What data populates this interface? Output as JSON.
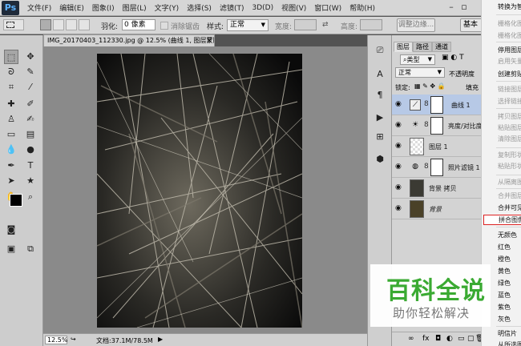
{
  "app": {
    "logo": "Ps"
  },
  "menubar": {
    "items": [
      "文件(F)",
      "编辑(E)",
      "图象(I)",
      "图层(L)",
      "文字(Y)",
      "选择(S)",
      "滤镜(T)",
      "3D(D)",
      "视图(V)",
      "窗口(W)",
      "帮助(H)"
    ]
  },
  "options": {
    "feather_label": "羽化:",
    "feather_value": "0 像素",
    "antialias_label": "消除锯齿",
    "style_label": "样式:",
    "style_value": "正常",
    "width_label": "宽度:",
    "height_label": "高度:",
    "refine_button": "调整边缘...",
    "workspace": "基本"
  },
  "document": {
    "tab_title": "IMG_20170403_112330.jpg @ 12.5% (曲线 1, 图层蒙版/8) *",
    "zoom": "12.5%",
    "doc_size": "文档:37.1M/78.5M"
  },
  "layers_panel": {
    "tabs": [
      "图层",
      "路径",
      "通道"
    ],
    "kind_filter": "类型",
    "blend_mode": "正常",
    "opacity_label": "不透明度",
    "lock_label": "锁定:",
    "fill_label": "填充",
    "layers": [
      {
        "name": "曲线 1",
        "visible": true,
        "type": "adjustment-curves",
        "selected": true
      },
      {
        "name": "亮度/对比度 1",
        "visible": true,
        "type": "adjustment-brightness",
        "selected": false
      },
      {
        "name": "图层 1",
        "visible": true,
        "type": "transparent",
        "selected": false
      },
      {
        "name": "照片滤镜 1",
        "visible": true,
        "type": "adjustment-photofilter",
        "selected": false
      },
      {
        "name": "背景 拷贝",
        "visible": true,
        "type": "image",
        "selected": false
      },
      {
        "name": "背景",
        "visible": true,
        "type": "image-locked",
        "selected": false
      }
    ],
    "footer_icons": [
      "link-icon",
      "fx-icon",
      "mask-icon",
      "adjustment-icon",
      "group-icon",
      "new-layer-icon",
      "trash-icon"
    ]
  },
  "context_menu": {
    "items": [
      {
        "label": "转换为智能对象",
        "dim": false
      },
      {
        "label": "栅格化图层",
        "dim": true
      },
      {
        "label": "栅格化图层样式",
        "dim": true
      },
      {
        "label": "停用图层蒙版",
        "dim": false
      },
      {
        "label": "启用矢量蒙版",
        "dim": true
      },
      {
        "label": "创建剪贴蒙版",
        "dim": false
      },
      {
        "label": "链接图层",
        "dim": true
      },
      {
        "label": "选择链接图层",
        "dim": true
      },
      {
        "label": "拷贝图层样式",
        "dim": true
      },
      {
        "label": "粘贴图层样式",
        "dim": true
      },
      {
        "label": "清除图层样式",
        "dim": true
      },
      {
        "label": "复制形状属性",
        "dim": true
      },
      {
        "label": "粘贴形状属性",
        "dim": true
      },
      {
        "label": "从隔离图层释放",
        "dim": true
      },
      {
        "label": "合并图层",
        "dim": true
      },
      {
        "label": "合并可见图层",
        "dim": false
      },
      {
        "label": "拼合图像",
        "dim": false,
        "highlight": true
      },
      {
        "label": "无颜色",
        "dim": false
      },
      {
        "label": "红色",
        "dim": false
      },
      {
        "label": "橙色",
        "dim": false
      },
      {
        "label": "黄色",
        "dim": false
      },
      {
        "label": "绿色",
        "dim": false
      },
      {
        "label": "蓝色",
        "dim": false
      },
      {
        "label": "紫色",
        "dim": false
      },
      {
        "label": "灰色",
        "dim": false
      },
      {
        "label": "明信片",
        "dim": false
      },
      {
        "label": "从所选图层新建3D模型",
        "dim": false
      }
    ]
  },
  "watermark": {
    "title": "百科全说",
    "subtitle": "助你轻松解决"
  },
  "colors": {
    "ps_blue": "#5fb4ff",
    "selected_layer": "#b7c9e6",
    "highlight_border": "#dd2222",
    "watermark_green": "#3aaa32"
  }
}
